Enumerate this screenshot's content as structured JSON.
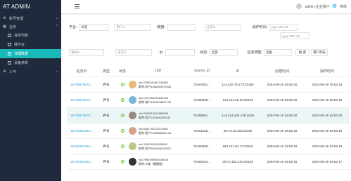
{
  "app": {
    "title": "AT ADMIN"
  },
  "sidebar": {
    "items": [
      {
        "label": "账号管理",
        "icon": "gear-icon"
      },
      {
        "label": "业务",
        "icon": "grid-icon"
      }
    ],
    "sub_items": [
      {
        "label": "任务列表"
      },
      {
        "label": "操作台"
      },
      {
        "label": "详细数据",
        "active": true
      },
      {
        "label": "设备参数"
      }
    ],
    "bottom_item": {
      "label": "人气",
      "icon": "gear-icon"
    }
  },
  "header": {
    "user": "admin-企业账户",
    "lang": "简体"
  },
  "filters": {
    "row1": {
      "platform_label": "平台:",
      "platform_value": "抖音",
      "userid_placeholder": "用户id",
      "link_label": "链接:",
      "business_placeholder": "业务id",
      "optime_label": "操作时间:",
      "date_start_placeholder": "yyyy-MM-dd",
      "date_end_placeholder": "yyyy-MM-dd"
    },
    "row2": {
      "my_id_placeholder": "我的id",
      "submit_placeholder": "提交id",
      "ip_label": "ip:",
      "state_label": "状态:",
      "state_value": "全部",
      "task_type_label": "任务类型:",
      "task_type_value": "全部",
      "search_button": "搜 索",
      "user_button": "用户列表"
    }
  },
  "table": {
    "headers": [
      "任务ID",
      "类型",
      "状态",
      "UID",
      "source_id",
      "ip",
      "创建时间",
      "操作时间"
    ],
    "rows": [
      {
        "id": "16706979670...",
        "type": "养号",
        "uid": "uid:3755541087136963",
        "nick": "昵称:用户4386955379428",
        "src": "72460061...",
        "ip": "114.220.75.173:20182",
        "created": "2023-06-19 19:52:20",
        "op": "2023-06-19 19:52:24",
        "avatar": "#e9b87a",
        "hl": false
      },
      {
        "id": "16706979670...",
        "type": "养号",
        "uid": "uid:1872456478245134",
        "nick": "昵称:用户4354508621705",
        "src": "72460358...",
        "ip": "125.124.28.10:20182",
        "created": "2023-06-19 19:52:20",
        "op": "2023-06-19 19:52:19",
        "avatar": "#7fb5d8",
        "hl": false
      },
      {
        "id": "16706979670...",
        "type": "养号",
        "uid": "uid:2542513616588334",
        "nick": "昵称:用户7206942557511",
        "src": "72459801...",
        "ip": "114.214.202.136:2018",
        "created": "2023-06-19 19:52:20",
        "op": "2023-06-19 19:52:22",
        "avatar": "#9a8a7a",
        "hl": true
      },
      {
        "id": "16706382354...",
        "type": "养号",
        "uid": "uid:8184793724370681",
        "nick": "昵称:用户7428988839148",
        "src": "72461052...",
        "ip": "49.73.43.162:20182",
        "created": "2023-06-19 19:52:18",
        "op": "2023-06-19 19:52:18",
        "avatar": "#d9a08f",
        "hl": false
      },
      {
        "id": "16706382354...",
        "type": "养号",
        "uid": "uid:3435302405038911",
        "nick": "昵称:用户9684636224922",
        "src": "72460365...",
        "ip": "183.131.84.71:20182",
        "created": "2023-06-19 19:52:18",
        "op": "2023-06-19 19:52:19",
        "avatar": "#b8c98a",
        "hl": false
      },
      {
        "id": "16706382354...",
        "type": "养号",
        "uid": "uid:2960359055438044",
        "nick": "昵称:大美（姗姗姐）",
        "src": "72452534...",
        "ip": "49.73.154.226:20182",
        "created": "2023-06-19 19:52:18",
        "op": "2023-06-19 19:52:17",
        "avatar": "#333333",
        "hl": false
      }
    ]
  },
  "colors": {
    "sidebar_bg": "#1f2b3c",
    "active": "#19b9b9",
    "link": "#2a9fd6",
    "success": "#52c41a"
  }
}
